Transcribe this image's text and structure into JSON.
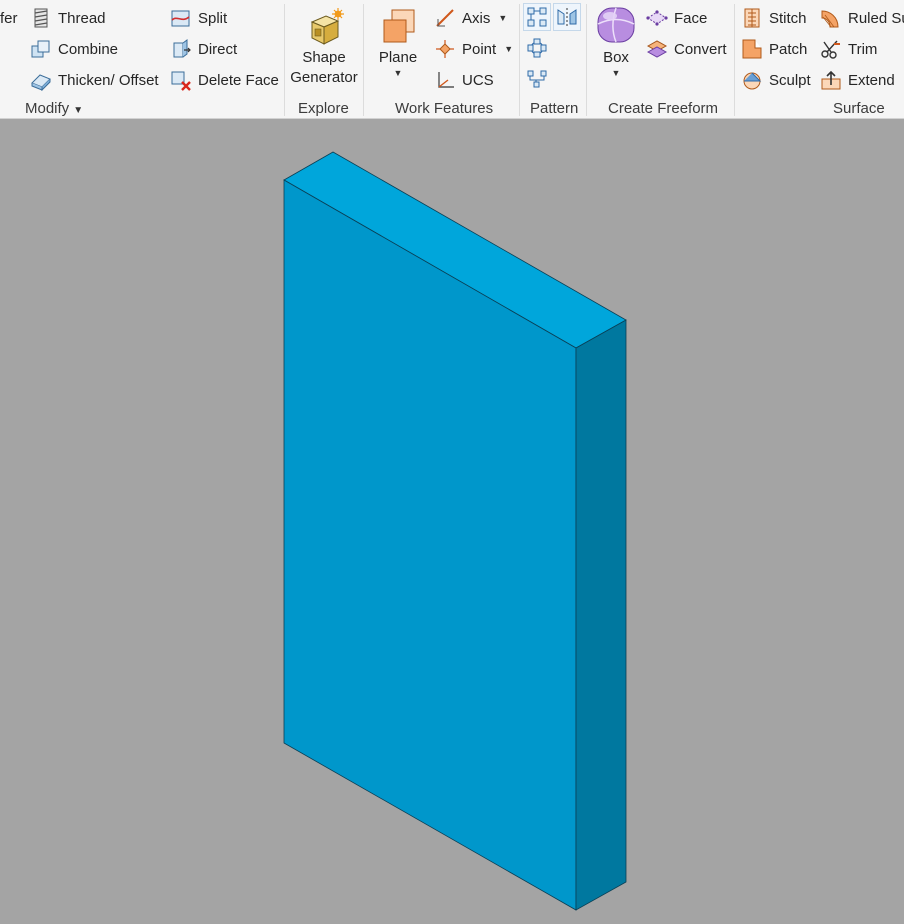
{
  "ribbon": {
    "modify": {
      "label": "Modify",
      "partial_label": "fer",
      "thread": "Thread",
      "combine": "Combine",
      "thicken": "Thicken/ Offset",
      "split": "Split",
      "direct": "Direct",
      "delete_face": "Delete Face"
    },
    "explore": {
      "label": "Explore",
      "shape_generator_line1": "Shape",
      "shape_generator_line2": "Generator"
    },
    "work_features": {
      "label": "Work Features",
      "plane": "Plane",
      "axis": "Axis",
      "point": "Point",
      "ucs": "UCS"
    },
    "pattern": {
      "label": "Pattern"
    },
    "freeform": {
      "label": "Create Freeform",
      "box": "Box",
      "face": "Face",
      "convert": "Convert"
    },
    "surface": {
      "label": "Surface",
      "stitch": "Stitch",
      "patch": "Patch",
      "sculpt": "Sculpt",
      "ruled": "Ruled Su",
      "trim": "Trim",
      "extend": "Extend"
    }
  },
  "colors": {
    "ribbon_bg": "#f5f5f5",
    "viewport_bg": "#a4a4a4",
    "block_front": "#0097cb",
    "block_top": "#00a6db",
    "block_side": "#00789f"
  }
}
